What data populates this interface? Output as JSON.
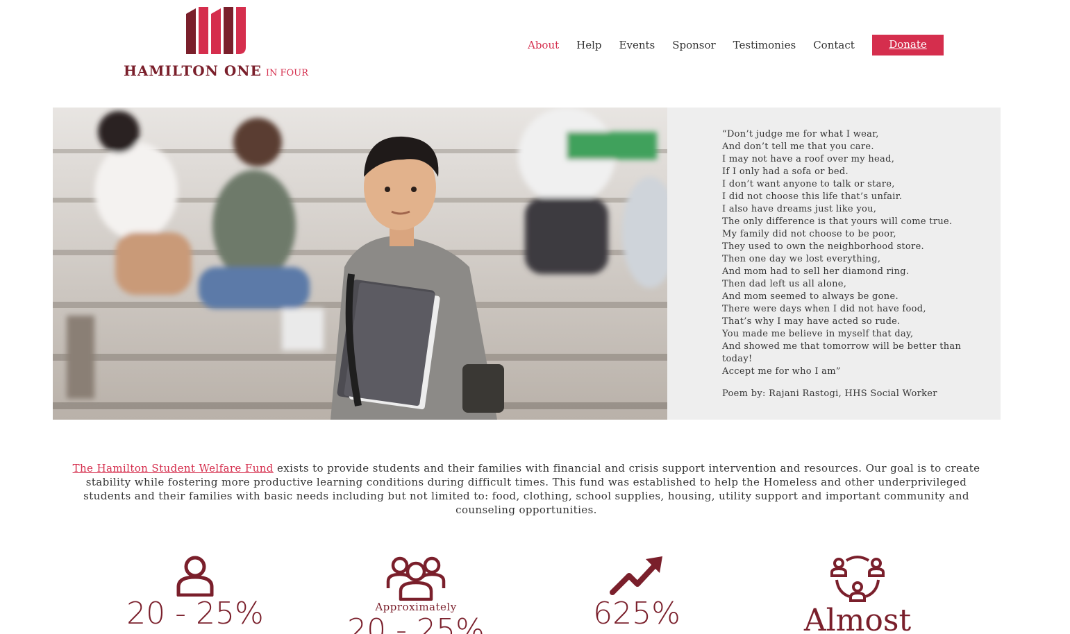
{
  "brand": {
    "name_main": "HAMILTON ONE",
    "name_accent": "IN FOUR",
    "colors": {
      "accent": "#d52e4d",
      "dark": "#7a1f2b",
      "panel": "#eeeeee"
    }
  },
  "nav": {
    "items": [
      {
        "label": "About",
        "active": true
      },
      {
        "label": "Help",
        "active": false
      },
      {
        "label": "Events",
        "active": false
      },
      {
        "label": "Sponsor",
        "active": false
      },
      {
        "label": "Testimonies",
        "active": false
      },
      {
        "label": "Contact",
        "active": false
      }
    ],
    "donate_label": "Donate"
  },
  "poem": {
    "lines": [
      "“Don’t judge me for what I wear,",
      "And don’t tell me that you care.",
      "I may not have a roof over my head,",
      "If I only had a sofa or bed.",
      "I don’t want anyone to talk or stare,",
      "I did not choose this life that’s unfair.",
      "I also have dreams just like you,",
      "The only difference is that yours will come true.",
      "My family did not choose to be poor,",
      "They used to own the neighborhood store.",
      "Then one day we lost everything,",
      "And mom had to sell her diamond ring.",
      "Then dad left us all alone,",
      "And mom seemed to always be gone.",
      "There were days when I did not have food,",
      "That’s why I may have acted so rude.",
      "You made me believe in myself that day,",
      "And showed me that tomorrow will be better than today!",
      "Accept me for who I am”"
    ],
    "credit": "Poem by: Rajani Rastogi, HHS Social Worker"
  },
  "intro": {
    "fund_name": "The Hamilton Student Welfare Fund",
    "text": " exists to provide students and their families with financial and crisis support intervention and resources. Our goal is to create stability while fostering more productive learning conditions during difficult times. This fund was established to help the Homeless and other underprivileged students and their families with basic needs including but not limited to: food, clothing, school supplies, housing, utility support and important community and counseling opportunities."
  },
  "stats": [
    {
      "icon": "person-icon",
      "pre": "",
      "value": "20 - 25%"
    },
    {
      "icon": "group-icon",
      "pre": "Approximately",
      "value": "20 - 25%"
    },
    {
      "icon": "trend-up-icon",
      "pre": "",
      "value": "625%"
    },
    {
      "icon": "network-icon",
      "pre": "",
      "value": "Almost"
    }
  ]
}
